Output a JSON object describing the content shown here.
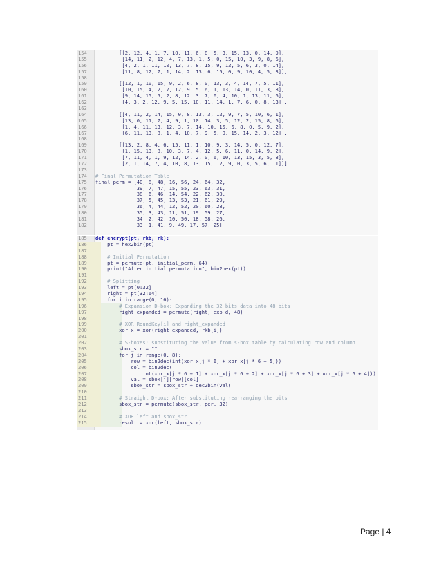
{
  "block1": [
    {
      "n": "154",
      "t": "        [[2, 12, 4, 1, 7, 10, 11, 6, 8, 5, 3, 15, 13, 0, 14, 9],",
      "k": "code"
    },
    {
      "n": "155",
      "t": "         [14, 11, 2, 12, 4, 7, 13, 1, 5, 0, 15, 10, 3, 9, 8, 6],",
      "k": "code"
    },
    {
      "n": "156",
      "t": "         [4, 2, 1, 11, 10, 13, 7, 8, 15, 9, 12, 5, 6, 3, 0, 14],",
      "k": "code"
    },
    {
      "n": "157",
      "t": "         [11, 8, 12, 7, 1, 14, 2, 13, 6, 15, 0, 9, 10, 4, 5, 3]],",
      "k": "code"
    },
    {
      "n": "158",
      "t": "",
      "k": "code"
    },
    {
      "n": "159",
      "t": "        [[12, 1, 10, 15, 9, 2, 6, 8, 0, 13, 3, 4, 14, 7, 5, 11],",
      "k": "code"
    },
    {
      "n": "160",
      "t": "         [10, 15, 4, 2, 7, 12, 9, 5, 6, 1, 13, 14, 0, 11, 3, 8],",
      "k": "code"
    },
    {
      "n": "161",
      "t": "         [9, 14, 15, 5, 2, 8, 12, 3, 7, 0, 4, 10, 1, 13, 11, 6],",
      "k": "code"
    },
    {
      "n": "162",
      "t": "         [4, 3, 2, 12, 9, 5, 15, 10, 11, 14, 1, 7, 6, 0, 8, 13]],",
      "k": "code"
    },
    {
      "n": "163",
      "t": "",
      "k": "code"
    },
    {
      "n": "164",
      "t": "        [[4, 11, 2, 14, 15, 0, 8, 13, 3, 12, 9, 7, 5, 10, 6, 1],",
      "k": "code"
    },
    {
      "n": "165",
      "t": "         [13, 0, 11, 7, 4, 9, 1, 10, 14, 3, 5, 12, 2, 15, 8, 6],",
      "k": "code"
    },
    {
      "n": "166",
      "t": "         [1, 4, 11, 13, 12, 3, 7, 14, 10, 15, 6, 8, 0, 5, 9, 2],",
      "k": "code"
    },
    {
      "n": "167",
      "t": "         [6, 11, 13, 8, 1, 4, 10, 7, 9, 5, 0, 15, 14, 2, 3, 12]],",
      "k": "code"
    },
    {
      "n": "168",
      "t": "",
      "k": "code"
    },
    {
      "n": "169",
      "t": "        [[13, 2, 8, 4, 6, 15, 11, 1, 10, 9, 3, 14, 5, 0, 12, 7],",
      "k": "code"
    },
    {
      "n": "170",
      "t": "         [1, 15, 13, 8, 10, 3, 7, 4, 12, 5, 6, 11, 0, 14, 9, 2],",
      "k": "code"
    },
    {
      "n": "171",
      "t": "         [7, 11, 4, 1, 9, 12, 14, 2, 0, 6, 10, 13, 15, 3, 5, 8],",
      "k": "code"
    },
    {
      "n": "172",
      "t": "         [2, 1, 14, 7, 4, 10, 8, 13, 15, 12, 9, 0, 3, 5, 6, 11]]]",
      "k": "code"
    },
    {
      "n": "173",
      "t": "",
      "k": "code"
    },
    {
      "n": "174",
      "t": "# Final Permutation Table",
      "k": "comment"
    },
    {
      "n": "175",
      "t": "final_perm = [40, 8, 48, 16, 56, 24, 64, 32,",
      "k": "code"
    },
    {
      "n": "176",
      "t": "              39, 7, 47, 15, 55, 23, 63, 31,",
      "k": "code"
    },
    {
      "n": "177",
      "t": "              38, 6, 46, 14, 54, 22, 62, 30,",
      "k": "code"
    },
    {
      "n": "178",
      "t": "              37, 5, 45, 13, 53, 21, 61, 29,",
      "k": "code"
    },
    {
      "n": "179",
      "t": "              36, 4, 44, 12, 52, 20, 60, 28,",
      "k": "code"
    },
    {
      "n": "180",
      "t": "              35, 3, 43, 11, 51, 19, 59, 27,",
      "k": "code"
    },
    {
      "n": "181",
      "t": "              34, 2, 42, 10, 50, 18, 58, 26,",
      "k": "code"
    },
    {
      "n": "182",
      "t": "              33, 1, 41, 9, 49, 17, 57, 25]",
      "k": "code"
    }
  ],
  "block2": [
    {
      "n": "185",
      "t": "def encrypt(pt, rkb, rk):",
      "k": "def"
    },
    {
      "n": "186",
      "t": "    pt = hex2bin(pt)",
      "k": "code",
      "i": 1
    },
    {
      "n": "187",
      "t": "",
      "k": "code",
      "i": 1
    },
    {
      "n": "188",
      "t": "    # Initial Permutation",
      "k": "comment",
      "i": 1
    },
    {
      "n": "189",
      "t": "    pt = permute(pt, initial_perm, 64)",
      "k": "code",
      "i": 1
    },
    {
      "n": "190",
      "t": "    print(\"After initial permutation\", bin2hex(pt))",
      "k": "code",
      "i": 1
    },
    {
      "n": "191",
      "t": "",
      "k": "code",
      "i": 1
    },
    {
      "n": "192",
      "t": "    # Splitting",
      "k": "comment",
      "i": 1
    },
    {
      "n": "193",
      "t": "    left = pt[0:32]",
      "k": "code",
      "i": 1
    },
    {
      "n": "194",
      "t": "    right = pt[32:64]",
      "k": "code",
      "i": 1
    },
    {
      "n": "195",
      "t": "    for i in range(0, 16):",
      "k": "code",
      "i": 1
    },
    {
      "n": "196",
      "t": "        # Expansion D-box: Expanding the 32 bits data into 48 bits",
      "k": "comment",
      "i": 2
    },
    {
      "n": "197",
      "t": "        right_expanded = permute(right, exp_d, 48)",
      "k": "code",
      "i": 2
    },
    {
      "n": "198",
      "t": "",
      "k": "code",
      "i": 2
    },
    {
      "n": "199",
      "t": "        # XOR RoundKey[i] and right_expanded",
      "k": "comment",
      "i": 2
    },
    {
      "n": "200",
      "t": "        xor_x = xor(right_expanded, rkb[i])",
      "k": "code",
      "i": 2
    },
    {
      "n": "201",
      "t": "",
      "k": "code",
      "i": 2
    },
    {
      "n": "202",
      "t": "        # S-boxes: substituting the value from s-box table by calculating row and column",
      "k": "comment",
      "i": 2
    },
    {
      "n": "203",
      "t": "        sbox_str = \"\"",
      "k": "code",
      "i": 2
    },
    {
      "n": "204",
      "t": "        for j in range(0, 8):",
      "k": "code",
      "i": 2
    },
    {
      "n": "205",
      "t": "            row = bin2dec(int(xor_x[j * 6] + xor_x[j * 6 + 5]))",
      "k": "code",
      "i": 2
    },
    {
      "n": "206",
      "t": "            col = bin2dec(",
      "k": "code",
      "i": 2
    },
    {
      "n": "207",
      "t": "                int(xor_x[j * 6 + 1] + xor_x[j * 6 + 2] + xor_x[j * 6 + 3] + xor_x[j * 6 + 4]))",
      "k": "code",
      "i": 2
    },
    {
      "n": "208",
      "t": "            val = sbox[j][row][col]",
      "k": "code",
      "i": 2
    },
    {
      "n": "209",
      "t": "            sbox_str = sbox_str + dec2bin(val)",
      "k": "code",
      "i": 2
    },
    {
      "n": "210",
      "t": "",
      "k": "code",
      "i": 2
    },
    {
      "n": "211",
      "t": "        # Straight D-box: After substituting rearranging the bits",
      "k": "comment",
      "i": 2
    },
    {
      "n": "212",
      "t": "        sbox_str = permute(sbox_str, per, 32)",
      "k": "code",
      "i": 2
    },
    {
      "n": "213",
      "t": "",
      "k": "code",
      "i": 2
    },
    {
      "n": "214",
      "t": "        # XOR left and sbox_str",
      "k": "comment",
      "i": 2
    },
    {
      "n": "215",
      "t": "        result = xor(left, sbox_str)",
      "k": "code",
      "i": 2
    }
  ],
  "footer": {
    "page_label": "Page | 4"
  }
}
